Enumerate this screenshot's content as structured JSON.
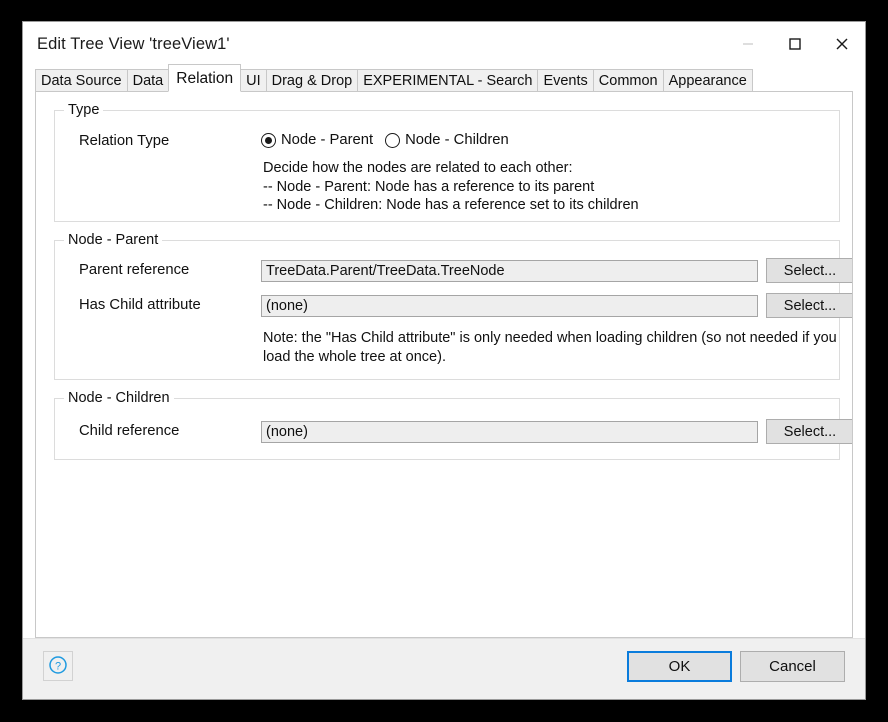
{
  "window": {
    "title": "Edit Tree View 'treeView1'",
    "controls": {
      "minimize": "minimize-icon",
      "maximize": "maximize-icon",
      "close": "close-icon"
    }
  },
  "tabs": [
    {
      "label": "Data Source",
      "selected": false
    },
    {
      "label": "Data",
      "selected": false
    },
    {
      "label": "Relation",
      "selected": true
    },
    {
      "label": "UI",
      "selected": false
    },
    {
      "label": "Drag & Drop",
      "selected": false
    },
    {
      "label": "EXPERIMENTAL - Search",
      "selected": false
    },
    {
      "label": "Events",
      "selected": false
    },
    {
      "label": "Common",
      "selected": false
    },
    {
      "label": "Appearance",
      "selected": false
    }
  ],
  "groups": {
    "type": {
      "title": "Type",
      "relation_type_label": "Relation Type",
      "options": [
        {
          "label": "Node - Parent",
          "checked": true
        },
        {
          "label": "Node - Children",
          "checked": false
        }
      ],
      "description": "Decide how the nodes are related to each other:\n-- Node - Parent: Node has a reference to its parent\n-- Node - Children: Node has a reference set to its children"
    },
    "node_parent": {
      "title": "Node - Parent",
      "parent_reference_label": "Parent reference",
      "parent_reference_value": "TreeData.Parent/TreeData.TreeNode",
      "parent_reference_select": "Select...",
      "has_child_attribute_label": "Has Child attribute",
      "has_child_attribute_value": "(none)",
      "has_child_attribute_select": "Select...",
      "note": "Note: the \"Has Child attribute\" is only needed when loading children (so not needed if you load the whole tree at once)."
    },
    "node_children": {
      "title": "Node - Children",
      "child_reference_label": "Child reference",
      "child_reference_value": "(none)",
      "child_reference_select": "Select..."
    }
  },
  "footer": {
    "help": "?",
    "ok": "OK",
    "cancel": "Cancel"
  },
  "colors": {
    "accent": "#0a7cdc",
    "help_icon": "#1e9ae0",
    "window_bg": "#ffffff",
    "footer_bg": "#f0f0f0",
    "field_bg": "#eeeeee",
    "button_bg": "#e1e1e1"
  }
}
